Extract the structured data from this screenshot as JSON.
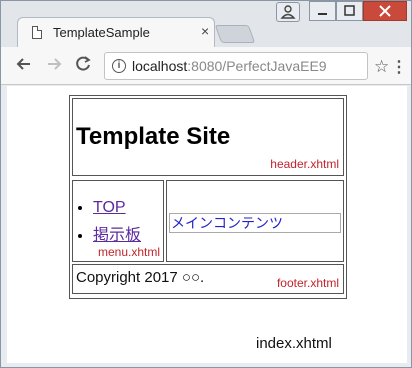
{
  "browser": {
    "tab_title": "TemplateSample",
    "tab_close": "×",
    "url_host": "localhost",
    "url_rest": ":8080/PerfectJavaEE9",
    "icons": [
      "page-icon",
      "back-icon",
      "forward-icon",
      "reload-icon",
      "info-icon",
      "star-icon",
      "menu-icon",
      "profile-icon",
      "minimize-icon",
      "maximize-icon",
      "close-icon"
    ]
  },
  "page": {
    "site_title": "Template Site",
    "header_label": "header.xhtml",
    "menu_items": [
      "TOP",
      "掲示板"
    ],
    "menu_label": "menu.xhtml",
    "content_text": "メインコンテンツ",
    "copyright": "Copyright 2017 ○○.",
    "footer_label": "footer.xhtml",
    "index_label": "index.xhtml"
  },
  "colors": {
    "file_label": "#c0242a",
    "link": "#5b2aa0",
    "content_text": "#2222cc",
    "close_button": "#c94a3a"
  }
}
